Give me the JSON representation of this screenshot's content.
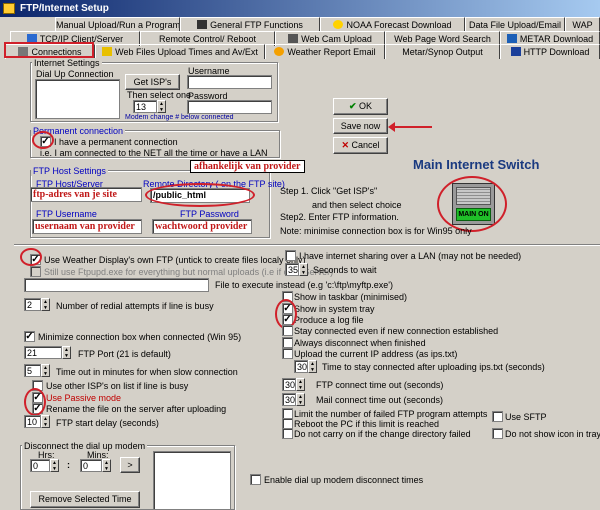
{
  "window": {
    "title": "FTP/Internet Setup"
  },
  "tabs": {
    "row1": [
      "Manual Upload/Run a Program",
      "General FTP Functions",
      "NOAA Forecast Download",
      "Data File Upload/Email",
      "WAP"
    ],
    "row2": [
      "TCP/IP Client/Server",
      "Remote Control/ Reboot",
      "Web Cam Upload",
      "Web Page Word Search",
      "METAR Download"
    ],
    "row3": [
      "Connections",
      "Web Files Upload Times and  Av/Ext",
      "Weather Report Email",
      "Metar/Synop Output",
      "HTTP Download"
    ]
  },
  "internet_settings": {
    "group": "Internet Settings",
    "dialup_label": "Dial Up Connection",
    "get_isps": "Get ISP's",
    "then_select": "Then select one",
    "modem_value": "13",
    "modem_note": "Modem change # below connected",
    "username_label": "Username",
    "password_label": "Password"
  },
  "permanent": {
    "group": "Permanent connection",
    "have_perm": "I have a permanent connection",
    "note": "i.e. I am connected to the NET all the time or have a LAN"
  },
  "buttons": {
    "ok": "OK",
    "save": "Save now",
    "cancel": "Cancel"
  },
  "main_switch": {
    "title": "Main Internet Switch",
    "status": "MAIN ON"
  },
  "ftp_host": {
    "group": "FTP Host Settings",
    "host_label": "FTP Host/Server",
    "host_value": "ftp-adres van je site",
    "remote_label": "Remote Directory ( on the FTP site)",
    "remote_value": "/public_html",
    "user_label": "FTP Username",
    "user_value": "usernaam van provider",
    "pass_label": "FTP Password",
    "pass_value": "wachtwoord provider",
    "provider_note": "afhankelijk van provider"
  },
  "steps": {
    "s1": "Step 1. Click  \"Get ISP's\"",
    "s1b": "and then select choice",
    "s2": "Step2. Enter FTP information.",
    "note": "Note: minimise connection box is for Win95 only"
  },
  "options_left": {
    "use_own_ftp": "Use Weather Display's own FTP  (untick to create files localy only)",
    "still_use": "Still use Ftpupd.exe for everything but normal uploads (i.e if on a Server)",
    "file_exec": "File to execute instead (e.g 'c:\\ftp\\myftp.exe')",
    "redial_value": "2",
    "redial_label": "Number of redial attempts if line is busy",
    "minimize": "Minimize connection box when connected (Win 95)",
    "port_value": "21",
    "port_label": "FTP Port (21 is default)",
    "timeout_value": "5",
    "timeout_label": "Time out in minutes for when slow connection",
    "other_isps": "Use other ISP's on list if line is busy",
    "passive": "Use Passive mode",
    "rename": "Rename the file on the server after uploading",
    "start_value": "10",
    "start_label": "FTP start delay (seconds)"
  },
  "options_right": {
    "lan": "I have internet sharing over a LAN (may not be needed)",
    "wait_value": "35",
    "wait_label": "Seconds to wait",
    "taskbar": "Show in taskbar (minimised)",
    "tray": "Show in system tray",
    "log": "Produce a log file",
    "stay": "Stay connected even if new connection established",
    "always": "Always disconnect when finished",
    "upload_ip": "Upload the current IP address (as ips.txt)",
    "ip_delay_value": "30",
    "ip_delay_label": "Time to stay connected after uploading ips.txt (seconds)",
    "conn_timeout_value": "30",
    "conn_timeout_label": "FTP connect time out (seconds)",
    "mail_timeout_value": "30",
    "mail_timeout_label": "Mail connect time out (seconds)",
    "limit": "Limit the number of failed FTP program attempts",
    "reboot": "Reboot the PC if this limit is reached",
    "no_carry": "Do not carry on if the change directory failed",
    "sftp": "Use SFTP",
    "no_icon": "Do not show icon in tray"
  },
  "disconnect": {
    "group": "Disconnect the dial up modem",
    "hrs_label": "Hrs:",
    "mins_label": "Mins:",
    "hrs_value": "0",
    "mins_value": "0",
    "add": ">",
    "remove": "Remove Selected Time",
    "enable": "Enable dial up modem disconnect times"
  }
}
